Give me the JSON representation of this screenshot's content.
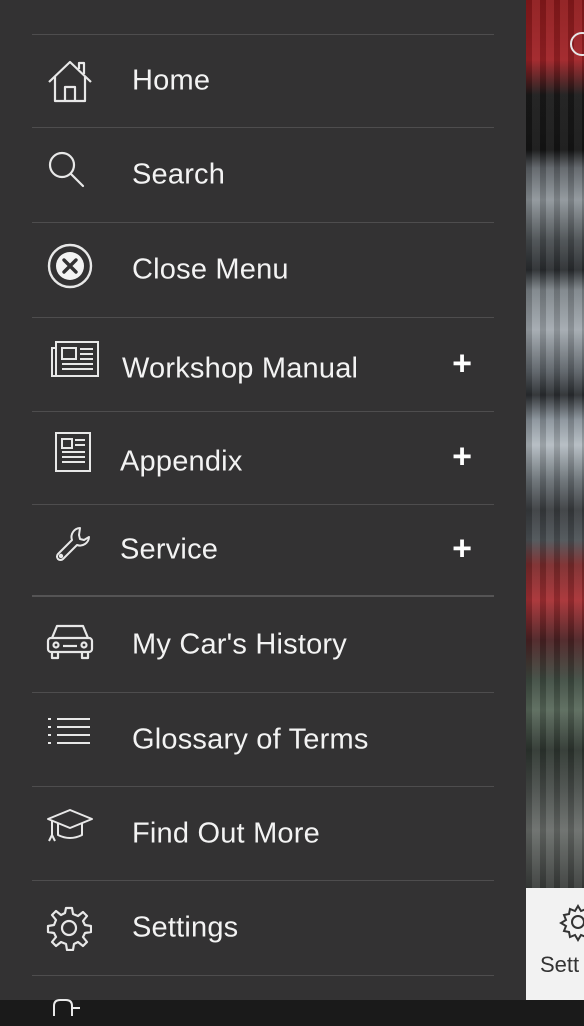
{
  "drawer": {
    "items": [
      {
        "label": "Home",
        "icon": "home-icon",
        "expandable": false
      },
      {
        "label": "Search",
        "icon": "search-icon",
        "expandable": false
      },
      {
        "label": "Close Menu",
        "icon": "close-icon",
        "expandable": false
      },
      {
        "label": "Workshop Manual",
        "icon": "newspaper-icon",
        "expandable": true
      },
      {
        "label": "Appendix",
        "icon": "document-icon",
        "expandable": true
      },
      {
        "label": "Service",
        "icon": "wrench-icon",
        "expandable": true
      },
      {
        "label": "My Car's History",
        "icon": "car-icon",
        "expandable": false
      },
      {
        "label": "Glossary of Terms",
        "icon": "list-icon",
        "expandable": false
      },
      {
        "label": "Find Out More",
        "icon": "graduation-cap-icon",
        "expandable": false
      },
      {
        "label": "Settings",
        "icon": "gear-icon",
        "expandable": false
      }
    ],
    "expand_symbol": "+"
  },
  "background": {
    "tab_label": "Sett",
    "tab_icon": "gear-icon"
  },
  "colors": {
    "drawer_bg": "#333233",
    "divider": "#4e4d4e",
    "text": "#f3f3f3",
    "tabbar_bg": "#f2f2f2"
  }
}
